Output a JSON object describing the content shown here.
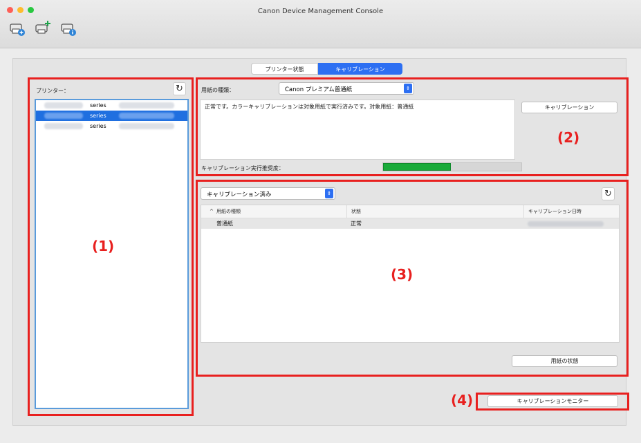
{
  "window": {
    "title": "Canon Device Management Console"
  },
  "toolbar": {
    "icons": [
      "add-printer-icon",
      "cloud-add-icon",
      "printer-info-icon"
    ]
  },
  "tabs": [
    {
      "label": "プリンター状態",
      "selected": false
    },
    {
      "label": "キャリブレーション",
      "selected": true
    }
  ],
  "left_panel": {
    "printer_label": "プリンター：",
    "printers": [
      {
        "name": "series",
        "selected": false
      },
      {
        "name": "series",
        "selected": true
      },
      {
        "name": "series",
        "selected": false
      }
    ],
    "callout": "(1)"
  },
  "calib_panel": {
    "media_label": "用紙の種類：",
    "media_value": "Canon プレミアム普通紙",
    "message": "正常です。カラーキャリブレーションは対象用紙で実行済みです。対象用紙：普通紙",
    "calibrate_button": "キャリブレーション",
    "progress_label": "キャリブレーション実行推奨度：",
    "progress_fraction": 0.49,
    "progress_color": "#1aab3a",
    "callout": "(2)"
  },
  "history_panel": {
    "filter_value": "キャリブレーション済み",
    "columns": [
      "用紙の種類",
      "状態",
      "キャリブレーション日時"
    ],
    "rows": [
      {
        "media": "普通紙",
        "status": "正常"
      }
    ],
    "paper_status_button": "用紙の状態",
    "callout": "(3)"
  },
  "footer": {
    "monitor_button": "キャリブレーションモニター",
    "callout": "(4)"
  },
  "colors": {
    "accent": "#2d6ff2",
    "highlight": "#e8201f",
    "selection": "#1f6fe0"
  }
}
